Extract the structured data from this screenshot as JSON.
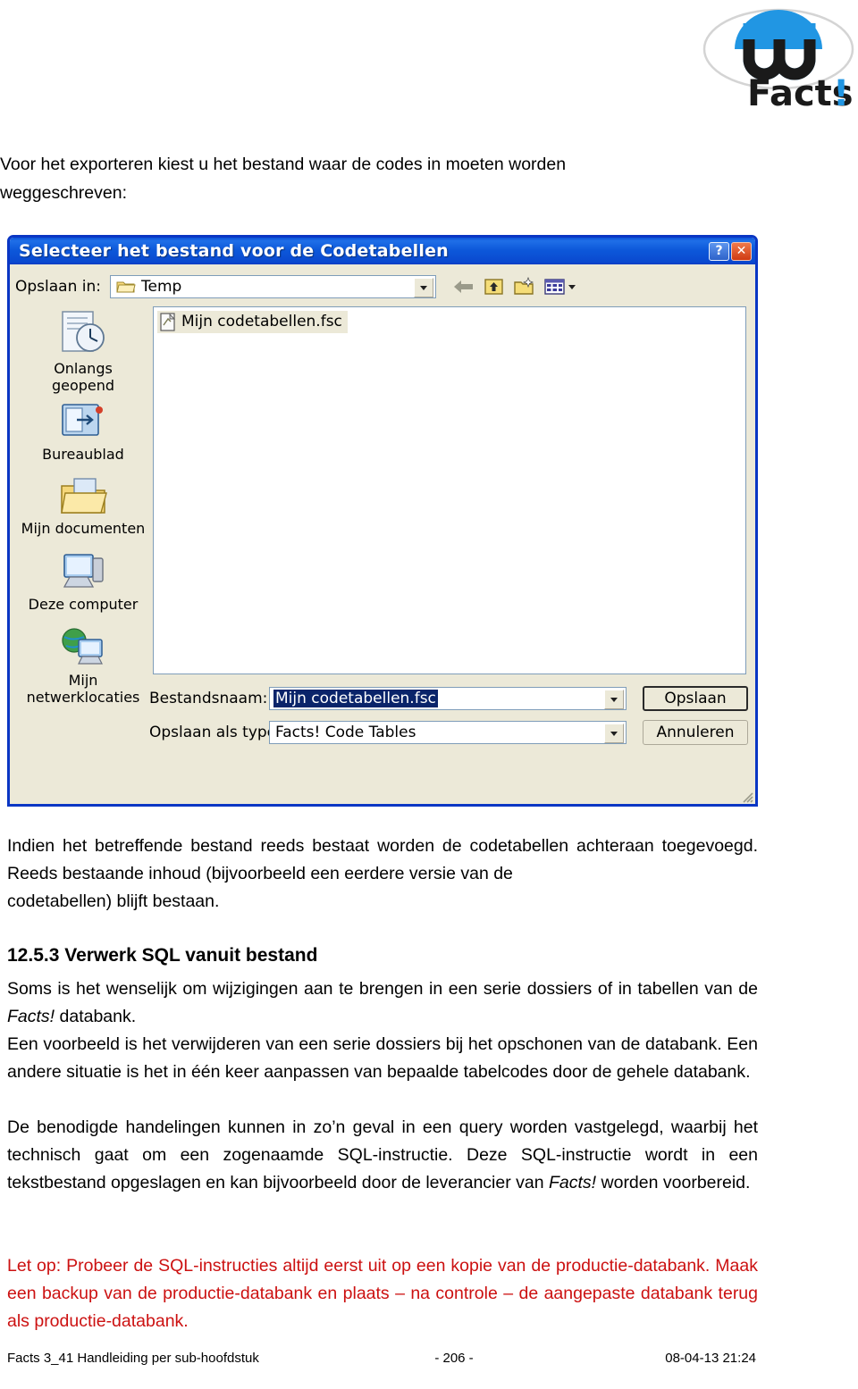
{
  "logo": {
    "wordmark": "Facts",
    "exclamation": "!",
    "brand_blue": "#2196e3",
    "brand_dark": "#1a1a1a"
  },
  "intro": {
    "line1": "Voor het exporteren kiest u het bestand waar de codes in moeten worden",
    "line2": "weggeschreven:"
  },
  "dialog": {
    "title": "Selecteer het bestand voor de Codetabellen",
    "help_button": "?",
    "close_button": "✕",
    "lookin_label": "Opslaan in:",
    "lookin_value": "Temp",
    "toolbar": {
      "back": "back-arrow",
      "up": "up-one-level",
      "new_folder": "create-new-folder",
      "views": "views-menu"
    },
    "places": [
      {
        "label": "Onlangs\ngeopend",
        "icon": "recent-documents-icon"
      },
      {
        "label": "Bureaublad",
        "icon": "desktop-icon"
      },
      {
        "label": "Mijn documenten",
        "icon": "my-documents-icon"
      },
      {
        "label": "Deze computer",
        "icon": "my-computer-icon"
      },
      {
        "label": "Mijn\nnetwerklocaties",
        "icon": "my-network-places-icon"
      }
    ],
    "files": [
      {
        "name": "Mijn codetabellen.fsc",
        "icon": "fsc-file-icon",
        "selected": true
      }
    ],
    "filename_label": "Bestandsnaam:",
    "filename_value": "Mijn codetabellen.fsc",
    "filetype_label": "Opslaan als type:",
    "filetype_value": "Facts! Code Tables",
    "save_button": "Opslaan",
    "cancel_button": "Annuleren"
  },
  "body": {
    "para1": "Indien het betreffende bestand reeds bestaat worden de codetabellen achteraan toegevoegd. Reeds bestaande inhoud (bijvoorbeeld een eerdere versie van de",
    "para1_last": "codetabellen) blijft bestaan.",
    "section_heading": "12.5.3 Verwerk SQL vanuit bestand",
    "para2_a": "Soms is het wenselijk om wijzigingen aan te brengen in een serie dossiers of in tabellen van de ",
    "para2_facts": "Facts!",
    "para2_b": " databank.",
    "para3": "Een voorbeeld is het verwijderen van een serie dossiers bij het opschonen van de databank. Een andere situatie is het in één keer aanpassen van bepaalde tabelcodes door de gehele databank.",
    "para4_a": "De benodigde handelingen kunnen in zo’n geval in een query worden vastgelegd, waarbij het technisch gaat om een zogenaamde SQL-instructie. Deze SQL-instructie wordt in een tekstbestand opgeslagen en kan bijvoorbeeld door de leverancier van ",
    "para4_facts": "Facts!",
    "para4_b": " worden voorbereid.",
    "warning": "Let op: Probeer de SQL-instructies altijd eerst uit op een kopie van de productie-databank. Maak een backup van de productie-databank en plaats – na controle – de aangepaste databank terug als productie-databank.",
    "warning_color": "#cc1111"
  },
  "footer": {
    "left": "Facts 3_41 Handleiding per sub-hoofdstuk",
    "page": "- 206 -",
    "timestamp": "08-04-13 21:24"
  }
}
